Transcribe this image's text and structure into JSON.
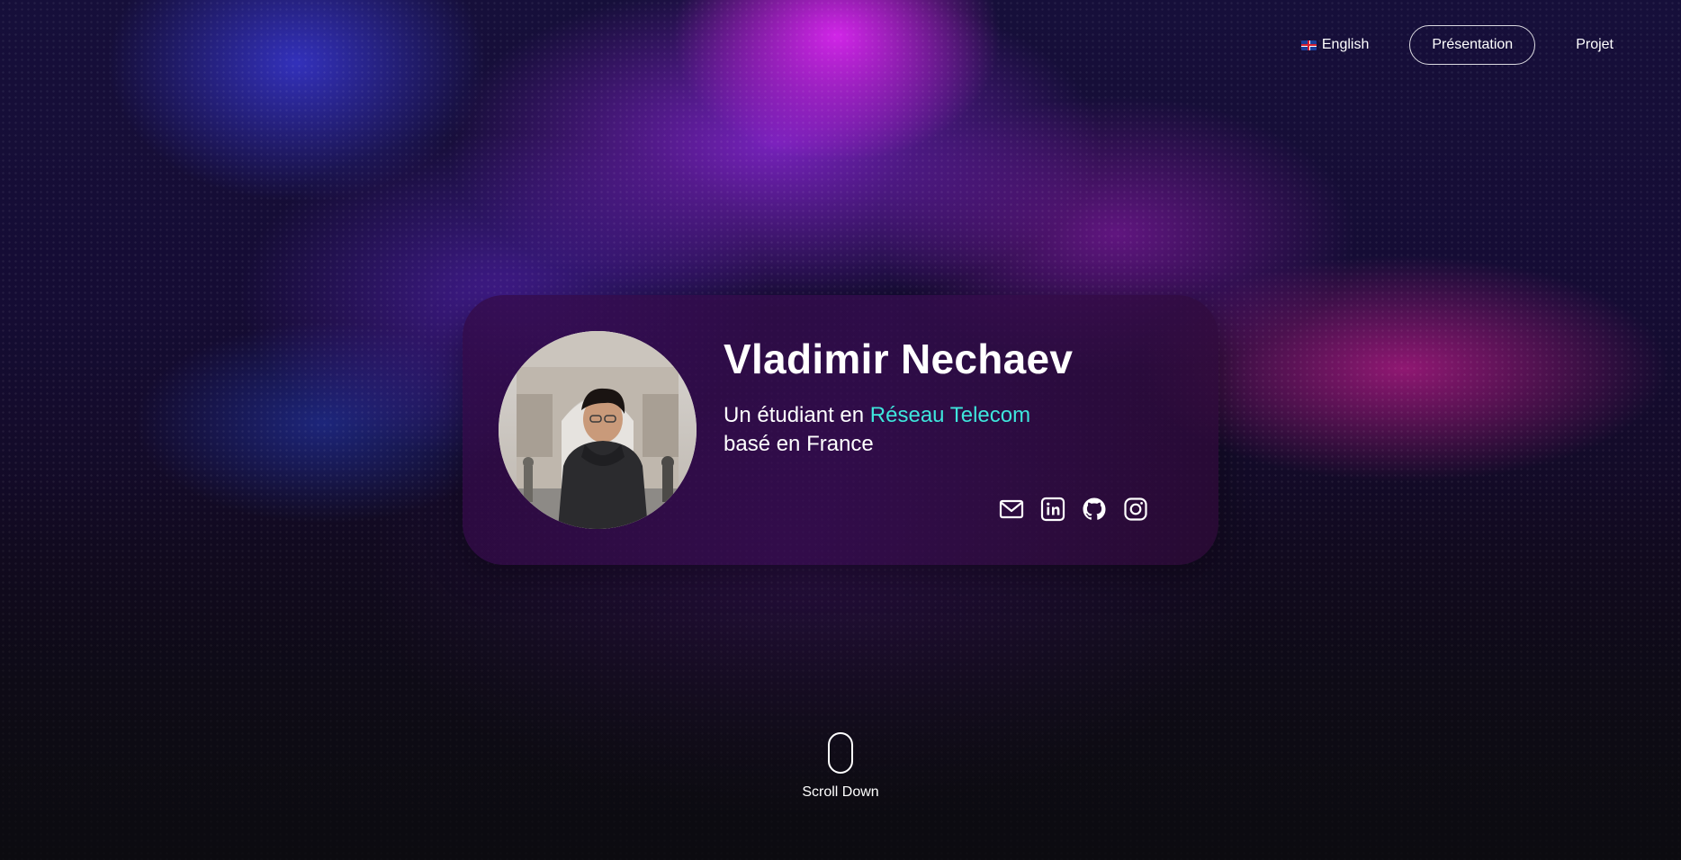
{
  "nav": {
    "language_label": "English",
    "language_icon": "uk-flag-icon",
    "items": [
      {
        "label": "Présentation",
        "active": true
      },
      {
        "label": "Projet",
        "active": false
      }
    ]
  },
  "profile": {
    "name": "Vladimir Nechaev",
    "tagline_prefix": "Un étudiant en ",
    "tagline_highlight": "Réseau Telecom",
    "tagline_suffix": "basé en France",
    "highlight_color": "#3ee6dc"
  },
  "socials": [
    {
      "icon": "mail-icon"
    },
    {
      "icon": "linkedin-icon"
    },
    {
      "icon": "github-icon"
    },
    {
      "icon": "instagram-icon"
    }
  ],
  "scroll": {
    "label": "Scroll Down"
  }
}
